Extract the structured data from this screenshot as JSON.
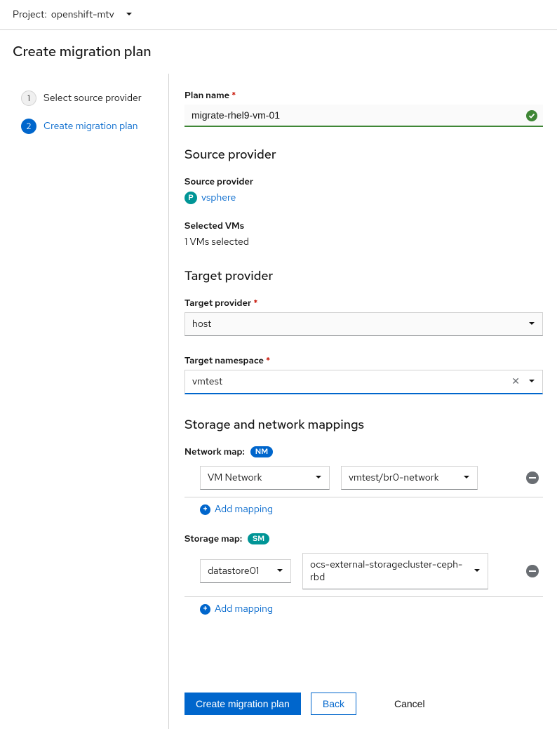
{
  "topbar": {
    "project_label": "Project:",
    "project_value": "openshift-mtv"
  },
  "page_title": "Create migration plan",
  "wizard": {
    "step1": {
      "num": "1",
      "label": "Select source provider"
    },
    "step2": {
      "num": "2",
      "label": "Create migration plan"
    }
  },
  "form": {
    "plan_name_label": "Plan name",
    "plan_name_value": "migrate-rhel9-vm-01",
    "source_provider_section": "Source provider",
    "source_provider_label": "Source provider",
    "source_provider_badge": "P",
    "source_provider_value": "vsphere",
    "selected_vms_label": "Selected VMs",
    "selected_vms_value": "1 VMs selected",
    "target_provider_section": "Target provider",
    "target_provider_label": "Target provider",
    "target_provider_value": "host",
    "target_namespace_label": "Target namespace",
    "target_namespace_value": "vmtest",
    "mappings_section": "Storage and network mappings",
    "network_map_label": "Network map:",
    "network_map_badge": "NM",
    "network_map_src": "VM Network",
    "network_map_tgt": "vmtest/br0-network",
    "storage_map_label": "Storage map:",
    "storage_map_badge": "SM",
    "storage_map_src": "datastore01",
    "storage_map_tgt": "ocs-external-storagecluster-ceph-rbd",
    "add_mapping": "Add mapping"
  },
  "footer": {
    "create": "Create migration plan",
    "back": "Back",
    "cancel": "Cancel"
  }
}
